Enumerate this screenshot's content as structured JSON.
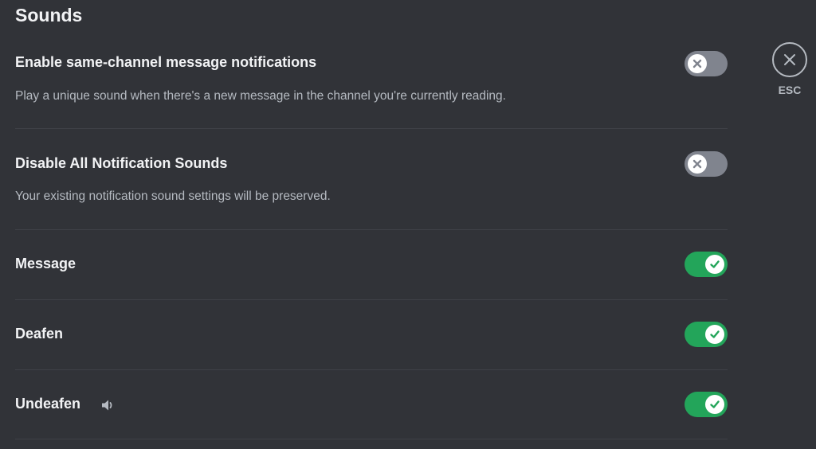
{
  "section": {
    "title": "Sounds"
  },
  "settings": [
    {
      "label": "Enable same-channel message notifications",
      "description": "Play a unique sound when there's a new message in the channel you're currently reading.",
      "enabled": false
    },
    {
      "label": "Disable All Notification Sounds",
      "description": "Your existing notification sound settings will be preserved.",
      "enabled": false
    },
    {
      "label": "Message",
      "enabled": true
    },
    {
      "label": "Deafen",
      "enabled": true
    },
    {
      "label": "Undeafen",
      "enabled": true,
      "icon": "speaker-icon"
    }
  ],
  "esc": {
    "label": "ESC",
    "icon": "close-icon"
  },
  "colors": {
    "background": "#313338",
    "toggle_on": "#23a55a",
    "toggle_off": "#80848e",
    "text_primary": "#f2f3f5",
    "text_secondary": "#b5bac1",
    "divider": "#3f4147"
  }
}
